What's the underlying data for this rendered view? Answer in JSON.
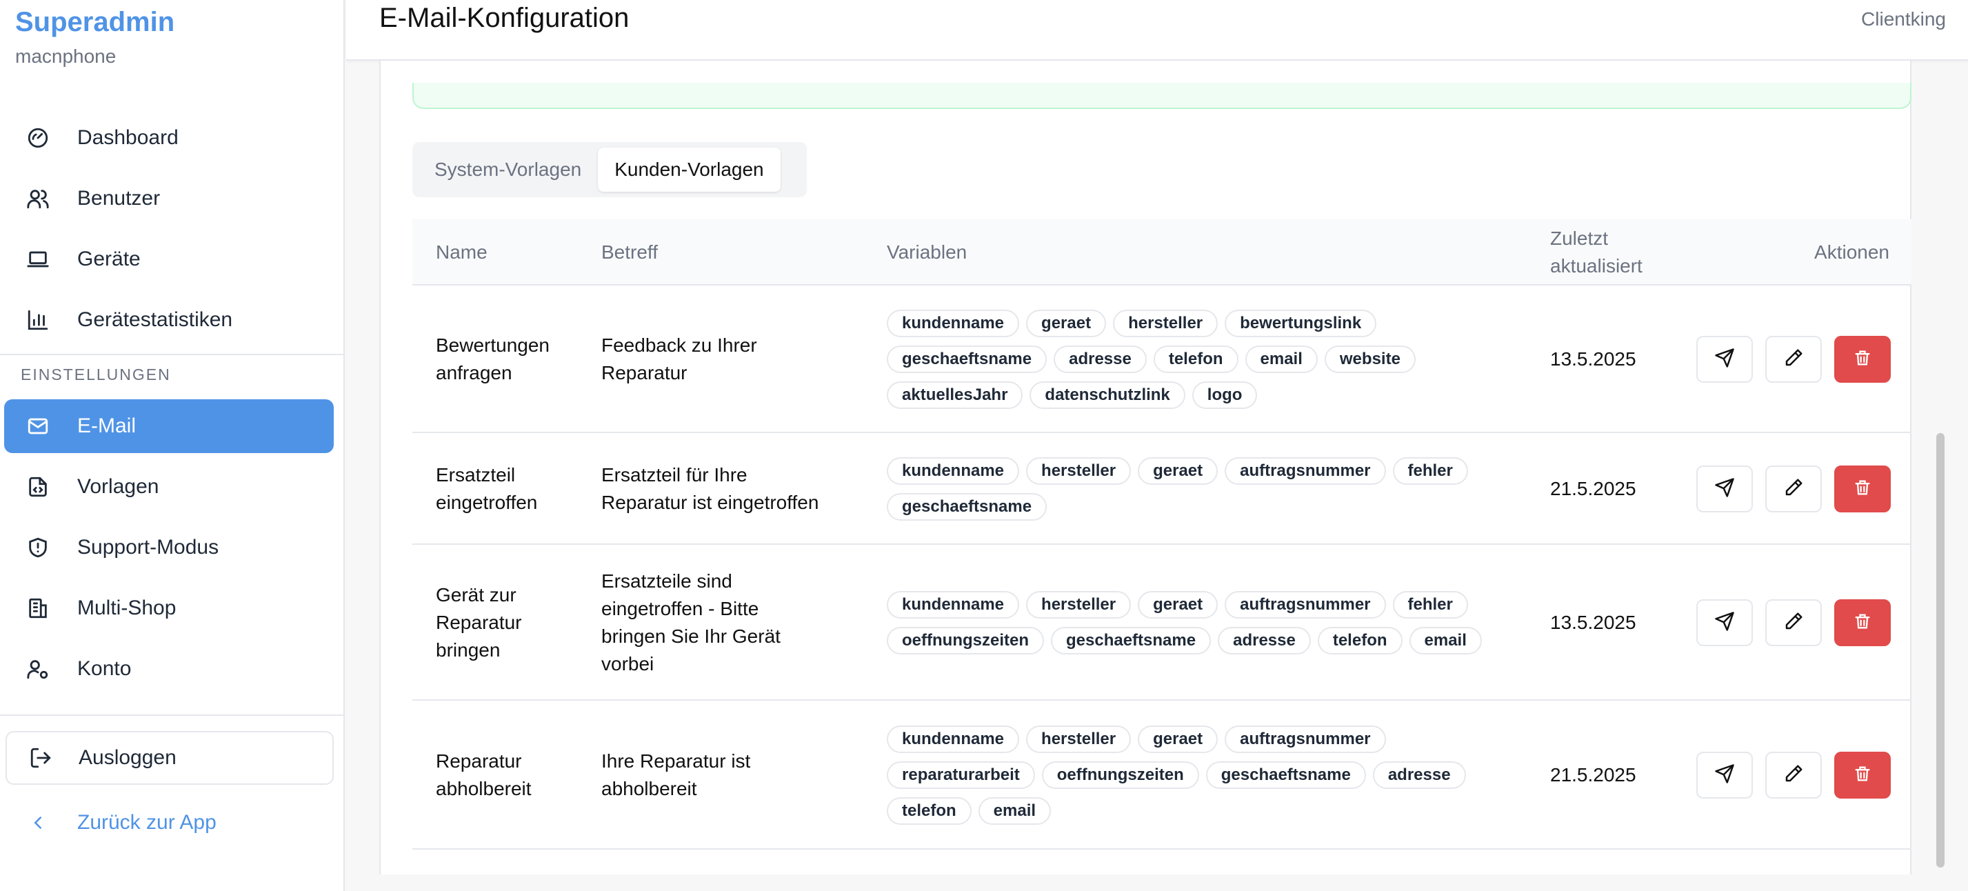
{
  "sidebar": {
    "title": "Superadmin",
    "subtitle": "macnphone",
    "nav": [
      {
        "label": "Dashboard",
        "icon": "gauge-icon"
      },
      {
        "label": "Benutzer",
        "icon": "users-icon"
      },
      {
        "label": "Geräte",
        "icon": "laptop-icon"
      },
      {
        "label": "Gerätestatistiken",
        "icon": "bar-chart-icon"
      }
    ],
    "section_label": "EINSTELLUNGEN",
    "settings": [
      {
        "label": "E-Mail",
        "icon": "mail-icon",
        "active": true
      },
      {
        "label": "Vorlagen",
        "icon": "file-code-icon"
      },
      {
        "label": "Support-Modus",
        "icon": "shield-icon"
      },
      {
        "label": "Multi-Shop",
        "icon": "building-icon"
      },
      {
        "label": "Konto",
        "icon": "user-cog-icon"
      }
    ],
    "logout_label": "Ausloggen",
    "back_label": "Zurück zur App"
  },
  "header": {
    "title": "E-Mail-Konfiguration",
    "user": "Clientking"
  },
  "tabs": [
    {
      "label": "System-Vorlagen",
      "active": false
    },
    {
      "label": "Kunden-Vorlagen",
      "active": true
    }
  ],
  "table": {
    "columns": {
      "name": "Name",
      "subject": "Betreff",
      "variables": "Variablen",
      "updated_line1": "Zuletzt",
      "updated_line2": "aktualisiert",
      "actions": "Aktionen"
    },
    "rows": [
      {
        "name": [
          "Bewertungen",
          "anfragen"
        ],
        "subject": [
          "Feedback zu Ihrer",
          "Reparatur"
        ],
        "variables": [
          "kundenname",
          "geraet",
          "hersteller",
          "bewertungslink",
          "geschaeftsname",
          "adresse",
          "telefon",
          "email",
          "website",
          "aktuellesJahr",
          "datenschutzlink",
          "logo"
        ],
        "updated": "13.5.2025"
      },
      {
        "name": [
          "Ersatzteil",
          "eingetroffen"
        ],
        "subject": [
          "Ersatzteil für Ihre",
          "Reparatur ist eingetroffen"
        ],
        "variables": [
          "kundenname",
          "hersteller",
          "geraet",
          "auftragsnummer",
          "fehler",
          "geschaeftsname"
        ],
        "updated": "21.5.2025"
      },
      {
        "name": [
          "Gerät zur",
          "Reparatur",
          "bringen"
        ],
        "subject": [
          "Ersatzteile sind",
          "eingetroffen - Bitte",
          "bringen Sie Ihr Gerät",
          "vorbei"
        ],
        "variables": [
          "kundenname",
          "hersteller",
          "geraet",
          "auftragsnummer",
          "fehler",
          "oeffnungszeiten",
          "geschaeftsname",
          "adresse",
          "telefon",
          "email"
        ],
        "updated": "13.5.2025"
      },
      {
        "name": [
          "Reparatur",
          "abholbereit"
        ],
        "subject": [
          "Ihre Reparatur ist",
          "abholbereit"
        ],
        "variables": [
          "kundenname",
          "hersteller",
          "geraet",
          "auftragsnummer",
          "reparaturarbeit",
          "oeffnungszeiten",
          "geschaeftsname",
          "adresse",
          "telefon",
          "email"
        ],
        "updated": "21.5.2025"
      }
    ]
  },
  "colors": {
    "accent": "#4f93e6",
    "danger": "#e14b4b"
  }
}
